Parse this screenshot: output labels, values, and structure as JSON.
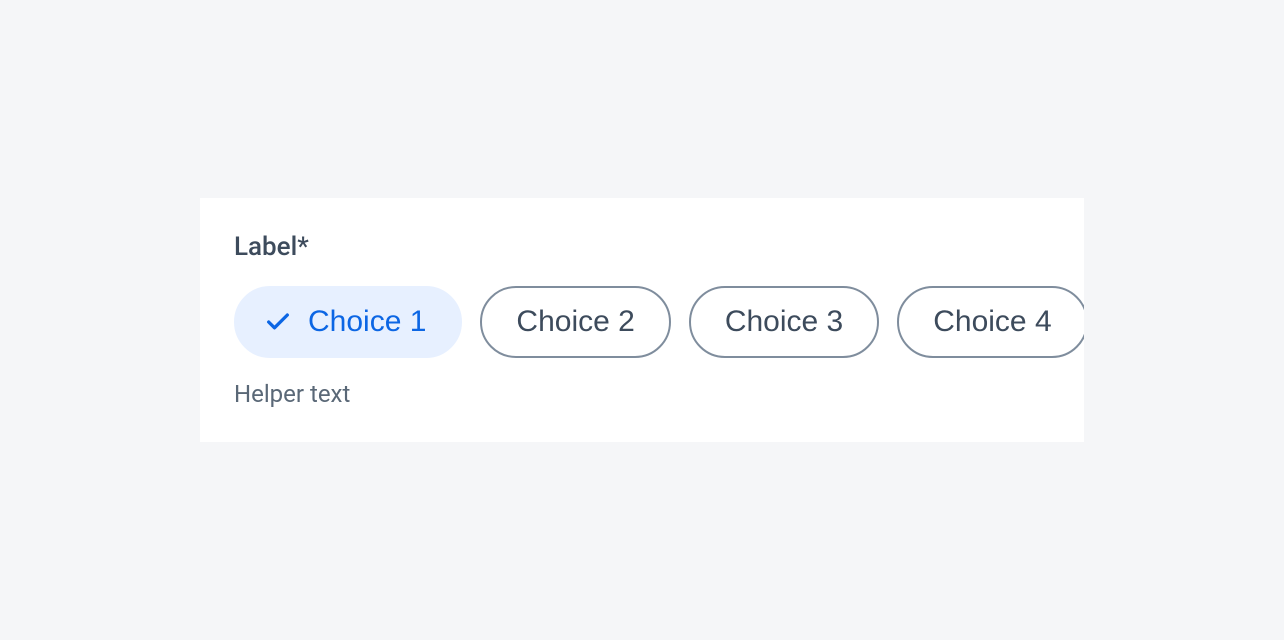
{
  "field": {
    "label": "Label*",
    "helper": "Helper text",
    "choices": [
      {
        "label": "Choice 1",
        "selected": true
      },
      {
        "label": "Choice 2",
        "selected": false
      },
      {
        "label": "Choice 3",
        "selected": false
      },
      {
        "label": "Choice 4",
        "selected": false
      }
    ]
  }
}
